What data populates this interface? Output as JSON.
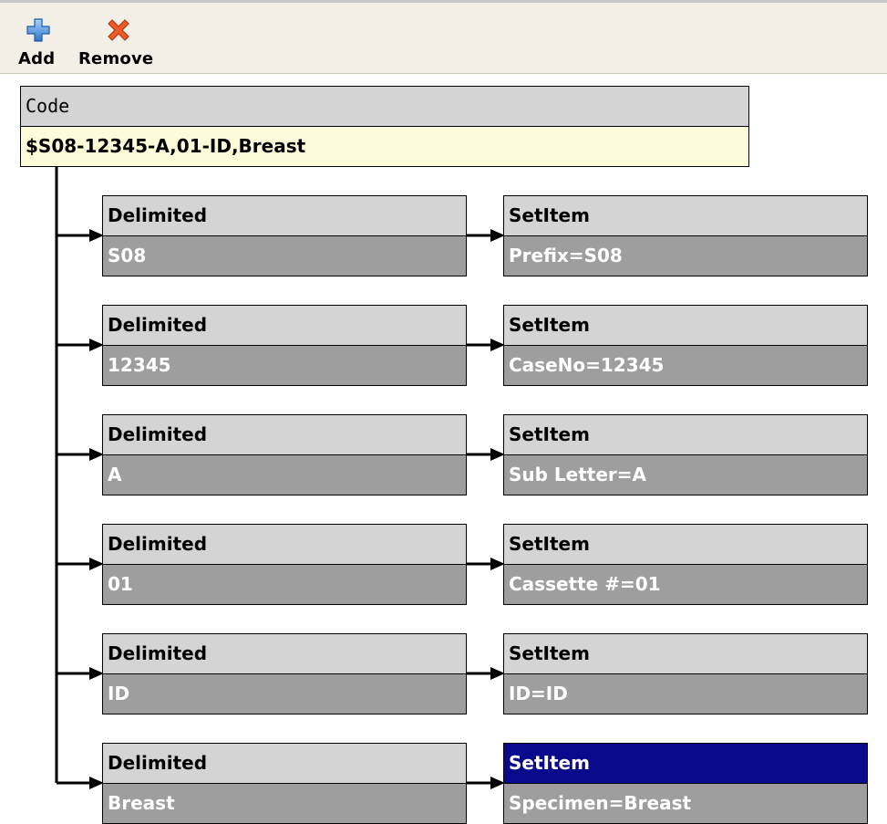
{
  "toolbar": {
    "add_label": "Add",
    "remove_label": "Remove",
    "add_icon": "plus-icon",
    "remove_icon": "x-icon",
    "add_color": "#3b82d9",
    "remove_color": "#e4572e"
  },
  "code_node": {
    "title": "Code",
    "value": "$S08-12345-A,01-ID,Breast"
  },
  "rows": [
    {
      "delimited": {
        "title": "Delimited",
        "value": "S08"
      },
      "setitem": {
        "title": "SetItem",
        "value": "Prefix=S08"
      }
    },
    {
      "delimited": {
        "title": "Delimited",
        "value": "12345"
      },
      "setitem": {
        "title": "SetItem",
        "value": "CaseNo=12345"
      }
    },
    {
      "delimited": {
        "title": "Delimited",
        "value": "A"
      },
      "setitem": {
        "title": "SetItem",
        "value": "Sub Letter=A"
      }
    },
    {
      "delimited": {
        "title": "Delimited",
        "value": "01"
      },
      "setitem": {
        "title": "SetItem",
        "value": "Cassette #=01"
      }
    },
    {
      "delimited": {
        "title": "Delimited",
        "value": "ID"
      },
      "setitem": {
        "title": "SetItem",
        "value": "ID=ID"
      }
    },
    {
      "delimited": {
        "title": "Delimited",
        "value": "Breast"
      },
      "setitem": {
        "title": "SetItem",
        "value": "Specimen=Breast",
        "selected": true
      }
    }
  ],
  "colors": {
    "header_gray": "#d4d4d4",
    "value_gray": "#9e9e9e",
    "code_value_bg": "#fdfbd8",
    "selected_header": "#0a0a8c"
  }
}
